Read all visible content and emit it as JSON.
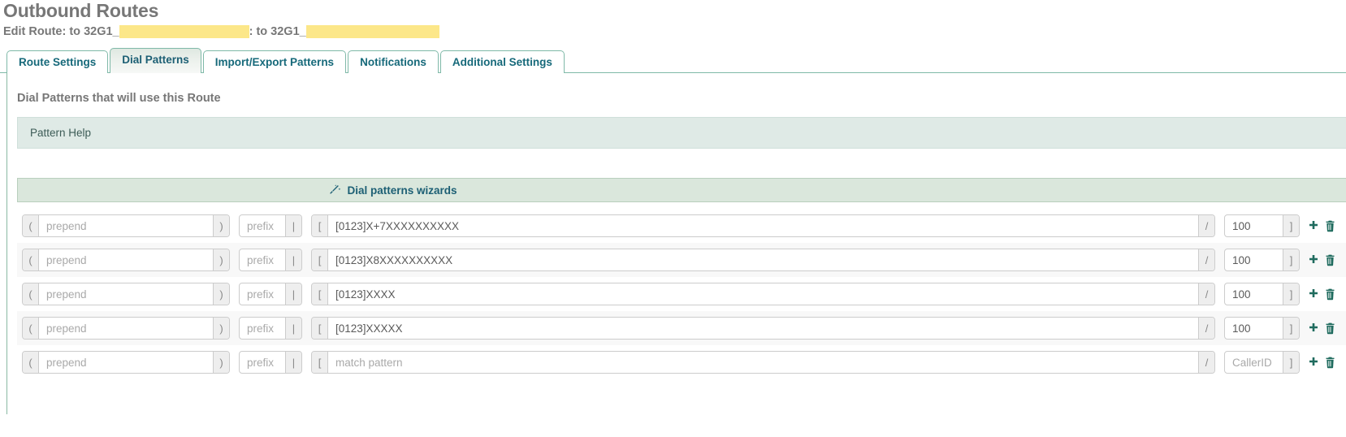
{
  "page": {
    "title": "Outbound Routes",
    "subtitle_prefix": "Edit Route: to 32G1_",
    "subtitle_middle": ": to 32G1_",
    "redacted": true
  },
  "tabs": [
    {
      "label": "Route Settings",
      "active": false
    },
    {
      "label": "Dial Patterns",
      "active": true
    },
    {
      "label": "Import/Export Patterns",
      "active": false
    },
    {
      "label": "Notifications",
      "active": false
    },
    {
      "label": "Additional Settings",
      "active": false
    }
  ],
  "section": {
    "heading": "Dial Patterns that will use this Route",
    "pattern_help_label": "Pattern Help",
    "wizards_label": "Dial patterns wizards",
    "wizards_icon": "magic-wand-icon"
  },
  "addons": {
    "prepend_open": "(",
    "prepend_close": ")",
    "prefix_pipe": "|",
    "match_open": "[",
    "match_slash": "/",
    "cid_close": "]"
  },
  "placeholders": {
    "prepend": "prepend",
    "prefix": "prefix",
    "match_pattern": "match pattern",
    "callerid": "CallerID"
  },
  "actions": {
    "add_icon": "plus-icon",
    "delete_icon": "trash-icon",
    "add_label": "Add",
    "delete_label": "Delete"
  },
  "rows": [
    {
      "prepend": "",
      "prefix": "",
      "match": "[0123]X+7XXXXXXXXXX",
      "callerid": "100"
    },
    {
      "prepend": "",
      "prefix": "",
      "match": "[0123]X8XXXXXXXXXX",
      "callerid": "100"
    },
    {
      "prepend": "",
      "prefix": "",
      "match": "[0123]XXXX",
      "callerid": "100"
    },
    {
      "prepend": "",
      "prefix": "",
      "match": "[0123]XXXXX",
      "callerid": "100"
    },
    {
      "prepend": "",
      "prefix": "",
      "match": "",
      "callerid": ""
    }
  ],
  "colors": {
    "accent_teal": "#16697a",
    "tab_border": "#7fb9a8",
    "help_bg": "#dfeae6",
    "wizard_bg": "#dae7dc",
    "redaction": "#FCE789",
    "title_gray": "#777777",
    "icon_green": "#1f6b5e"
  }
}
